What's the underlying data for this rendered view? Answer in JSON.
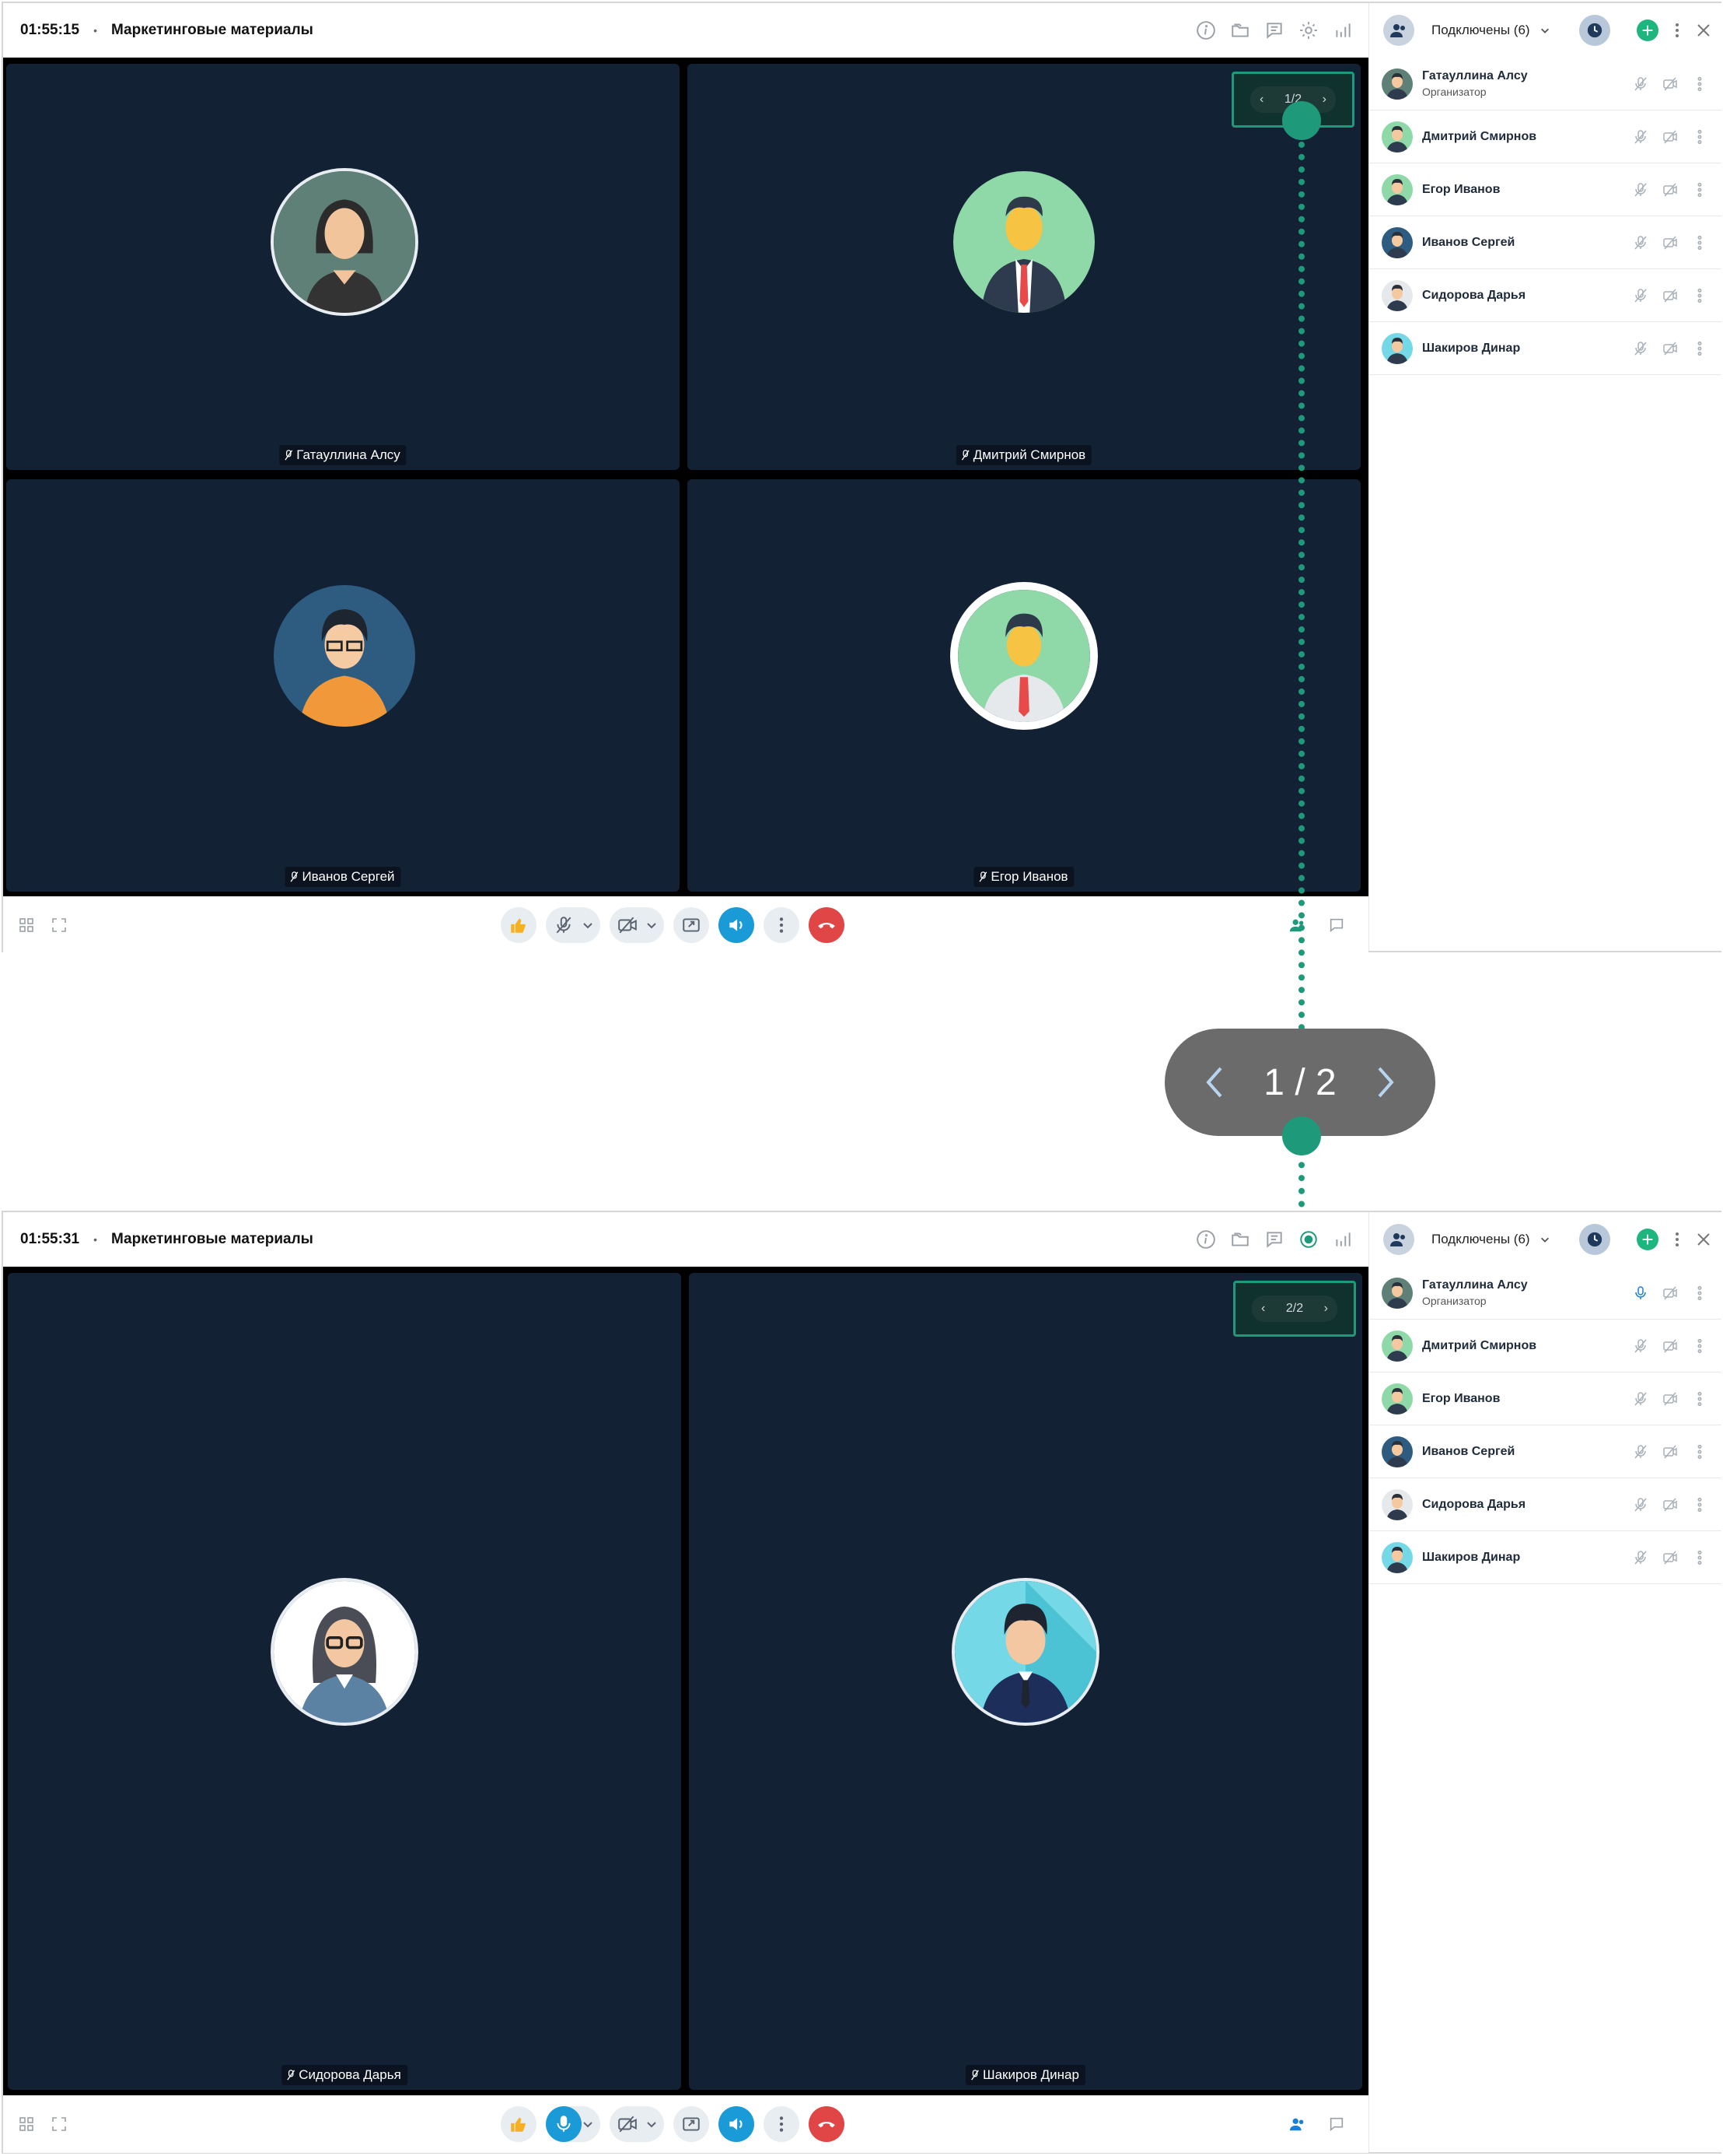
{
  "colors": {
    "accent": "#1e9a7a",
    "stage": "#132135",
    "hangup": "#e04646",
    "active_blue": "#1a9ad6"
  },
  "top": {
    "time": "01:55:15",
    "meeting_title": "Маркетинговые материалы",
    "pager": "1/2",
    "participants_count": "Подключены (6)",
    "tiles": [
      "Гатауллина Алсу",
      "Дмитрий Смирнов",
      "Иванов Сергей",
      "Егор Иванов"
    ]
  },
  "bottom": {
    "time": "01:55:31",
    "meeting_title": "Маркетинговые материалы",
    "pager": "2/2",
    "participants_count": "Подключены (6)",
    "tiles": [
      "Сидорова Дарья",
      "Шакиров Динар"
    ]
  },
  "participants": [
    {
      "name": "Гатауллина Алсу",
      "role": "Организатор"
    },
    {
      "name": "Дмитрий Смирнов",
      "role": ""
    },
    {
      "name": "Егор Иванов",
      "role": ""
    },
    {
      "name": "Иванов Сергей",
      "role": ""
    },
    {
      "name": "Сидорова Дарья",
      "role": ""
    },
    {
      "name": "Шакиров Динар",
      "role": ""
    }
  ],
  "zoom_callout": "1 / 2"
}
